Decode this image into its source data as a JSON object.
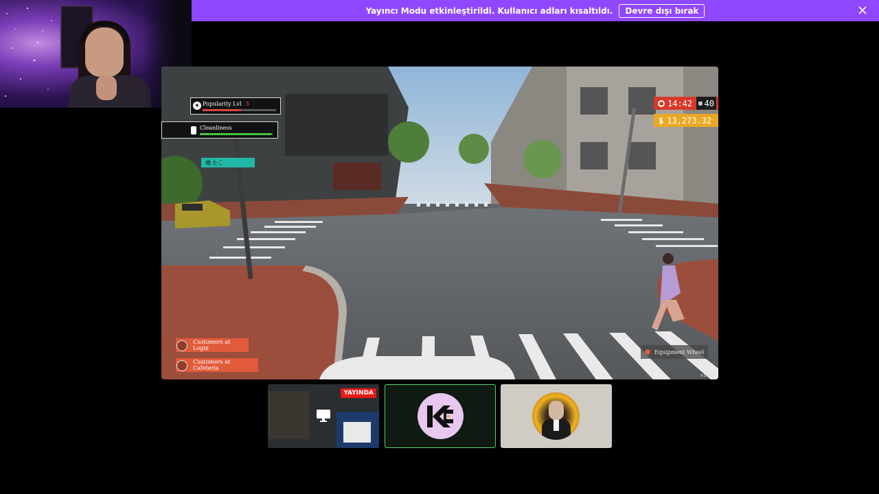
{
  "banner": {
    "message": "Yayıncı Modu etkinleştirildi. Kullanıcı adları kısaltıldı.",
    "disable_label": "Devre dışı bırak",
    "close_icon": "close-icon",
    "color": "#9147ff"
  },
  "webcam": {
    "icon": "webcam-feed"
  },
  "game": {
    "hud": {
      "popularity_label": "Popularity Lvl",
      "popularity_level": "5",
      "popularity_progress": 0.52,
      "cleanliness_label": "Cleanliness",
      "cleanliness_progress": 0.98,
      "time": "14:42",
      "day": "40",
      "money_symbol": "$",
      "money": "13,273.32"
    },
    "sign_text": "機 たこ",
    "buttons": {
      "customers_login": "Customers at Login",
      "customers_cafeteria": "Customers at Cafeteria",
      "equipment_wheel": "Equipment Wheel"
    },
    "version": "v1.0.2",
    "colors": {
      "time_bg": "#d7392a",
      "money_bg": "#e8a923",
      "pill_bg": "#e15b3b",
      "popularity_bar": "#d8473a",
      "cleanliness_bar": "#45c43e"
    }
  },
  "tiles": {
    "live_badge": "YAYINDA",
    "tile1_icon": "screen-share-icon",
    "tile2_icon": "kc-logo",
    "tile3_icon": "avatar"
  }
}
